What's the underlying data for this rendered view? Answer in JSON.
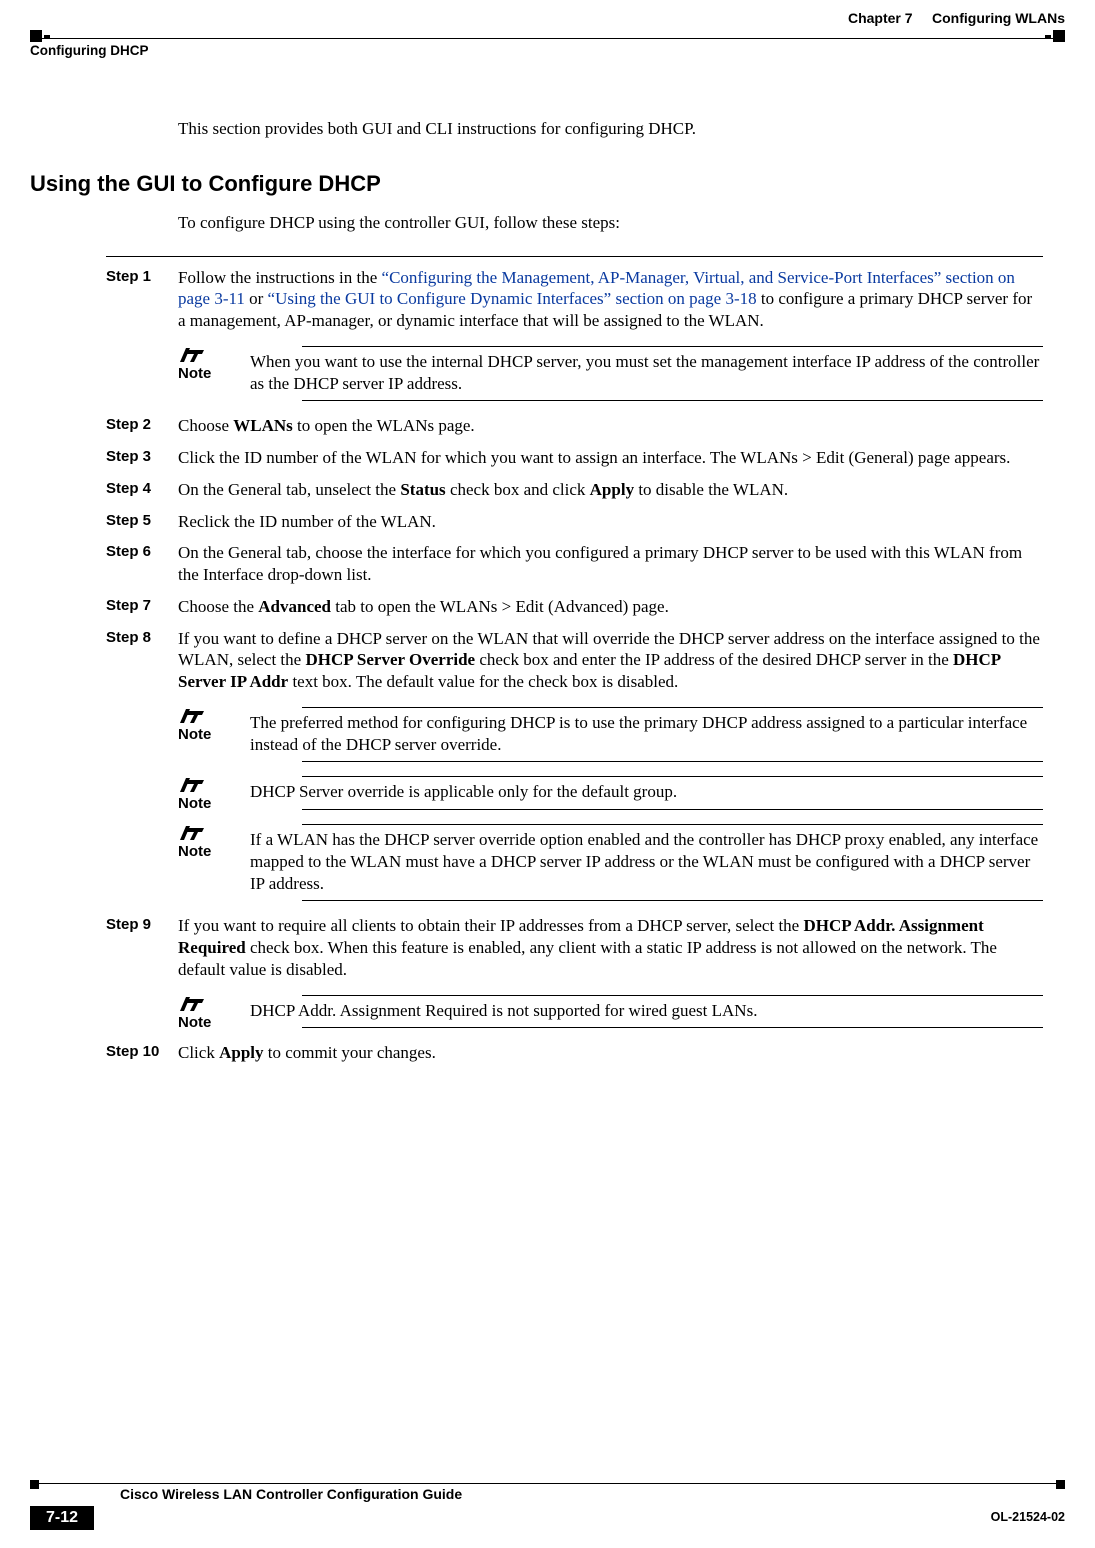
{
  "header": {
    "chapter": "Chapter 7",
    "chapter_title": "Configuring WLANs",
    "section": "Configuring DHCP"
  },
  "intro": "This section provides both GUI and CLI instructions for configuring DHCP.",
  "h2": "Using the GUI to Configure DHCP",
  "lead": "To configure DHCP using the controller GUI, follow these steps:",
  "steps": {
    "s1": {
      "label": "Step 1",
      "pre": "Follow the instructions in the ",
      "link1": "“Configuring the Management, AP-Manager, Virtual, and Service-Port Interfaces” section on page 3-11",
      "mid": " or ",
      "link2": "“Using the GUI to Configure Dynamic Interfaces” section on page 3-18",
      "post": " to configure a primary DHCP server for a management, AP-manager, or dynamic interface that will be assigned to the WLAN.",
      "note": "When you want to use the internal DHCP server, you must set the management interface IP address of the controller as the DHCP server IP address."
    },
    "s2": {
      "label": "Step 2",
      "pre": "Choose ",
      "b1": "WLANs",
      "post": " to open the WLANs page."
    },
    "s3": {
      "label": "Step 3",
      "text": "Click the ID number of the WLAN for which you want to assign an interface. The WLANs > Edit (General) page appears."
    },
    "s4": {
      "label": "Step 4",
      "pre": "On the General tab, unselect the ",
      "b1": "Status",
      "mid": " check box and click ",
      "b2": "Apply",
      "post": " to disable the WLAN."
    },
    "s5": {
      "label": "Step 5",
      "text": "Reclick the ID number of the WLAN."
    },
    "s6": {
      "label": "Step 6",
      "text": "On the General tab, choose the interface for which you configured a primary DHCP server to be used with this WLAN from the Interface drop-down list."
    },
    "s7": {
      "label": "Step 7",
      "pre": "Choose the ",
      "b1": "Advanced",
      "post": " tab to open the WLANs > Edit (Advanced) page."
    },
    "s8": {
      "label": "Step 8",
      "pre": "If you want to define a DHCP server on the WLAN that will override the DHCP server address on the interface assigned to the WLAN, select the ",
      "b1": "DHCP Server Override",
      "mid": " check box and enter the IP address of the desired DHCP server in the ",
      "b2": "DHCP Server IP Addr",
      "post": " text box. The default value for the check box is disabled.",
      "note1": "The preferred method for configuring DHCP is to use the primary DHCP address assigned to a particular interface instead of the DHCP server override.",
      "note2": "DHCP Server override is applicable only for the default group.",
      "note3": "If a WLAN has the DHCP server override option enabled and the controller has DHCP proxy enabled, any interface mapped to the WLAN must have a DHCP server IP address or the WLAN must be configured with a DHCP server IP address."
    },
    "s9": {
      "label": "Step 9",
      "pre": "If you want to require all clients to obtain their IP addresses from a DHCP server, select the ",
      "b1": "DHCP Addr. Assignment Required",
      "post": " check box. When this feature is enabled, any client with a static IP address is not allowed on the network. The default value is disabled.",
      "note": "DHCP Addr. Assignment Required is not supported for wired guest LANs."
    },
    "s10": {
      "label": "Step 10",
      "pre": "Click ",
      "b1": "Apply",
      "post": " to commit your changes."
    }
  },
  "labels": {
    "note": "Note"
  },
  "footer": {
    "guide": "Cisco Wireless LAN Controller Configuration Guide",
    "page": "7-12",
    "doc": "OL-21524-02"
  }
}
